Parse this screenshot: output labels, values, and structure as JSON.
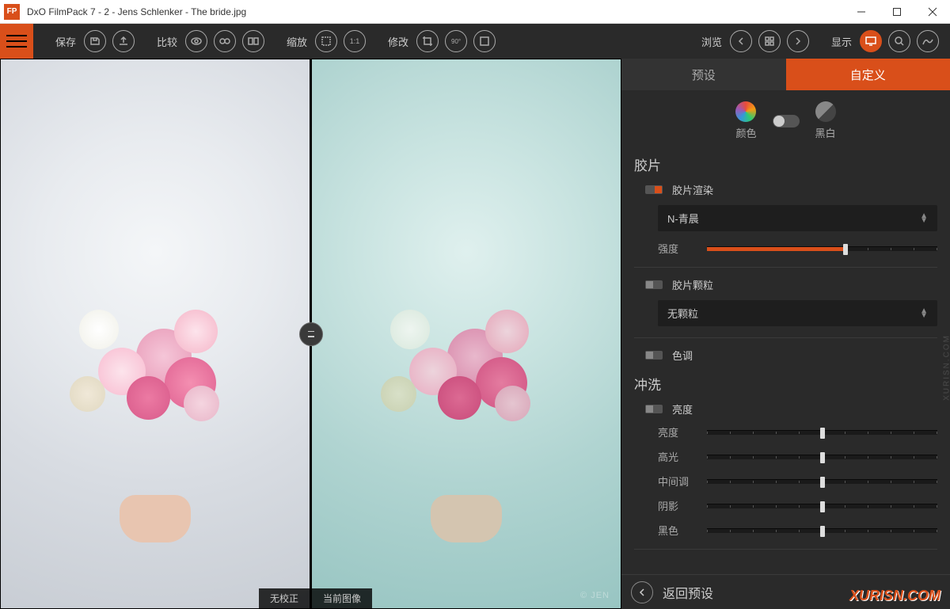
{
  "window": {
    "title": "DxO FilmPack 7 - 2 - Jens Schlenker - The bride.jpg",
    "app_badge": "FP"
  },
  "toolbar": {
    "save": "保存",
    "compare": "比较",
    "zoom": "缩放",
    "one_to_one": "1:1",
    "modify": "修改",
    "rotate_deg": "90°",
    "browse": "浏览",
    "display": "显示"
  },
  "viewer": {
    "left_label": "无校正",
    "right_label": "当前图像",
    "watermark": "© JEN"
  },
  "panel": {
    "tab_presets": "预设",
    "tab_custom": "自定义",
    "color_label": "颜色",
    "bw_label": "黑白",
    "section_film": "胶片",
    "film_render": "胶片渲染",
    "film_select": "N-青晨",
    "intensity_label": "强度",
    "intensity_pct": 60,
    "film_grain": "胶片颗粒",
    "grain_select": "无颗粒",
    "tone": "色调",
    "section_develop": "冲洗",
    "brightness_group": "亮度",
    "sliders": [
      {
        "label": "亮度",
        "pct": 50
      },
      {
        "label": "高光",
        "pct": 50
      },
      {
        "label": "中间调",
        "pct": 50
      },
      {
        "label": "阴影",
        "pct": 50
      },
      {
        "label": "黑色",
        "pct": 50
      }
    ],
    "back_label": "返回预设"
  },
  "watermarks": {
    "side": "XURISN.COM",
    "corner": "XURISN.COM"
  }
}
